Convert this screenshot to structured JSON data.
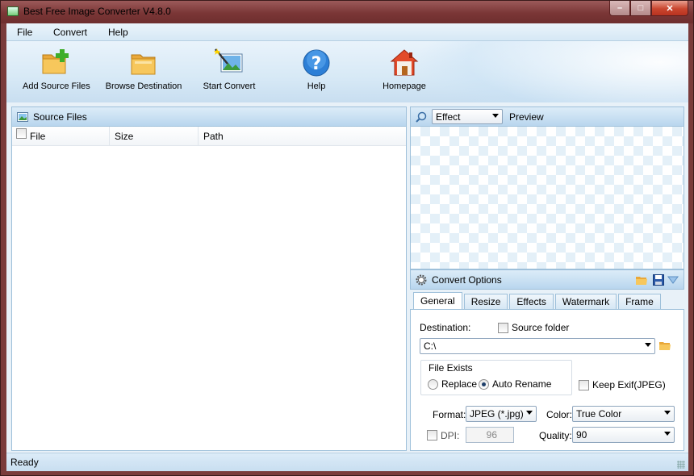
{
  "window": {
    "title": "Best Free Image Converter V4.8.0",
    "min": "–",
    "max": "□",
    "close": "✕"
  },
  "menu": {
    "file": "File",
    "convert": "Convert",
    "help": "Help"
  },
  "toolbar": {
    "add_source": "Add Source Files",
    "browse_dest": "Browse Destination",
    "start_convert": "Start Convert",
    "help": "Help",
    "homepage": "Homepage"
  },
  "source": {
    "title": "Source Files",
    "columns": {
      "file": "File",
      "size": "Size",
      "path": "Path"
    }
  },
  "preview": {
    "effect_value": "Effect",
    "title": "Preview"
  },
  "options": {
    "title": "Convert Options",
    "tabs": [
      "General",
      "Resize",
      "Effects",
      "Watermark",
      "Frame"
    ],
    "destination_label": "Destination:",
    "source_folder_label": "Source folder",
    "destination_value": "C:\\",
    "file_exists_label": "File Exists",
    "replace_label": "Replace",
    "auto_rename_label": "Auto Rename",
    "keep_exif_label": "Keep Exif(JPEG)",
    "format_label": "Format:",
    "format_value": "JPEG (*.jpg)",
    "color_label": "Color:",
    "color_value": "True Color",
    "dpi_label": "DPI:",
    "dpi_value": "96",
    "quality_label": "Quality:",
    "quality_value": "90"
  },
  "status": {
    "text": "Ready"
  }
}
